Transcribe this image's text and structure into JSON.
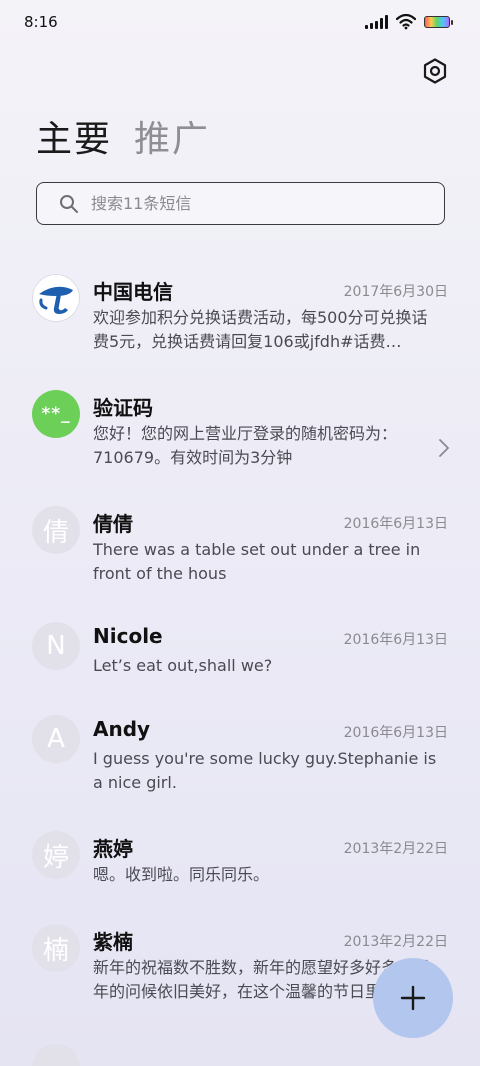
{
  "status": {
    "time": "8:16"
  },
  "tabs": [
    {
      "label": "主要",
      "active": true
    },
    {
      "label": "推广",
      "active": false
    }
  ],
  "search": {
    "placeholder": "搜索11条短信"
  },
  "messages": [
    {
      "avatar": "",
      "name": "中国电信",
      "date": "2017年6月30日",
      "preview": "欢迎参加积分兑换话费活动，每500分可兑换话费5元，兑换话费请回复106或jfdh#话费…"
    },
    {
      "avatar": "**_",
      "name": "验证码",
      "date": "",
      "preview": "您好！您的网上营业厅登录的随机密码为：710679。有效时间为3分钟"
    },
    {
      "avatar": "倩",
      "name": "倩倩",
      "date": "2016年6月13日",
      "preview": "There was a table set out under a tree in front of the hous"
    },
    {
      "avatar": "N",
      "name": "Nicole",
      "date": "2016年6月13日",
      "preview": "Let’s eat out,shall we?"
    },
    {
      "avatar": "A",
      "name": "Andy",
      "date": "2016年6月13日",
      "preview": "I guess you're some lucky guy.Stephanie is a nice girl."
    },
    {
      "avatar": "婷",
      "name": "燕婷",
      "date": "2013年2月22日",
      "preview": "嗯。收到啦。同乐同乐。"
    },
    {
      "avatar": "楠",
      "name": "紫楠",
      "date": "2013年2月22日",
      "preview": "新年的祝福数不胜数，新年的愿望好多好多，新年的问候依旧美好，在这个温馨的节日里"
    }
  ],
  "icons": {
    "settings": "gear-icon",
    "search": "search-icon",
    "compose": "plus-icon",
    "chevron": "chevron-right-icon"
  },
  "colors": {
    "accent": "#b3c6ee",
    "code_avatar": "#6bcf58",
    "brand_blue": "#1f5fb0"
  }
}
